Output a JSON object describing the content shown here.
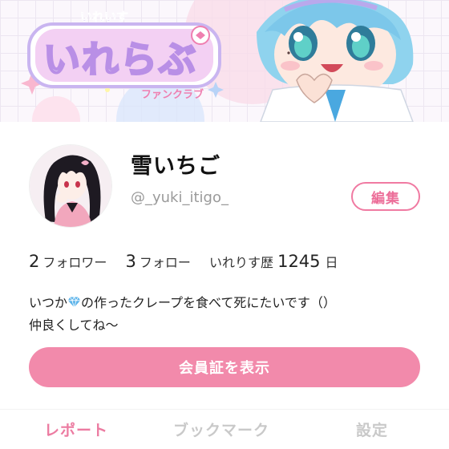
{
  "banner": {
    "logo_small": "いれいす",
    "logo_main": "いれらぶ",
    "logo_sub": "ファンクラブ"
  },
  "profile": {
    "display_name": "雪いちご",
    "user_id": "@_yuki_itigo_",
    "edit_label": "編集"
  },
  "stats": {
    "followers_count": "2",
    "followers_label": "フォロワー",
    "following_count": "3",
    "following_label": "フォロー",
    "history_label": "いれりす歴",
    "history_days": "1245",
    "history_unit": "日"
  },
  "bio": {
    "line1_before": "いつか",
    "line1_after": "の作ったクレープを食べて死にたいです（）",
    "line2": "仲良くしてね〜",
    "emoji_icon": "gem-icon"
  },
  "member_button": {
    "label": "会員証を表示"
  },
  "tabs": [
    {
      "label": "レポート",
      "active": true
    },
    {
      "label": "ブックマーク",
      "active": false
    },
    {
      "label": "設定",
      "active": false
    }
  ],
  "colors": {
    "accent_pink": "#f28aab",
    "tab_active": "#ec7ba1",
    "tab_inactive": "#c9c9c9",
    "gem_blue": "#5ab3ea"
  }
}
